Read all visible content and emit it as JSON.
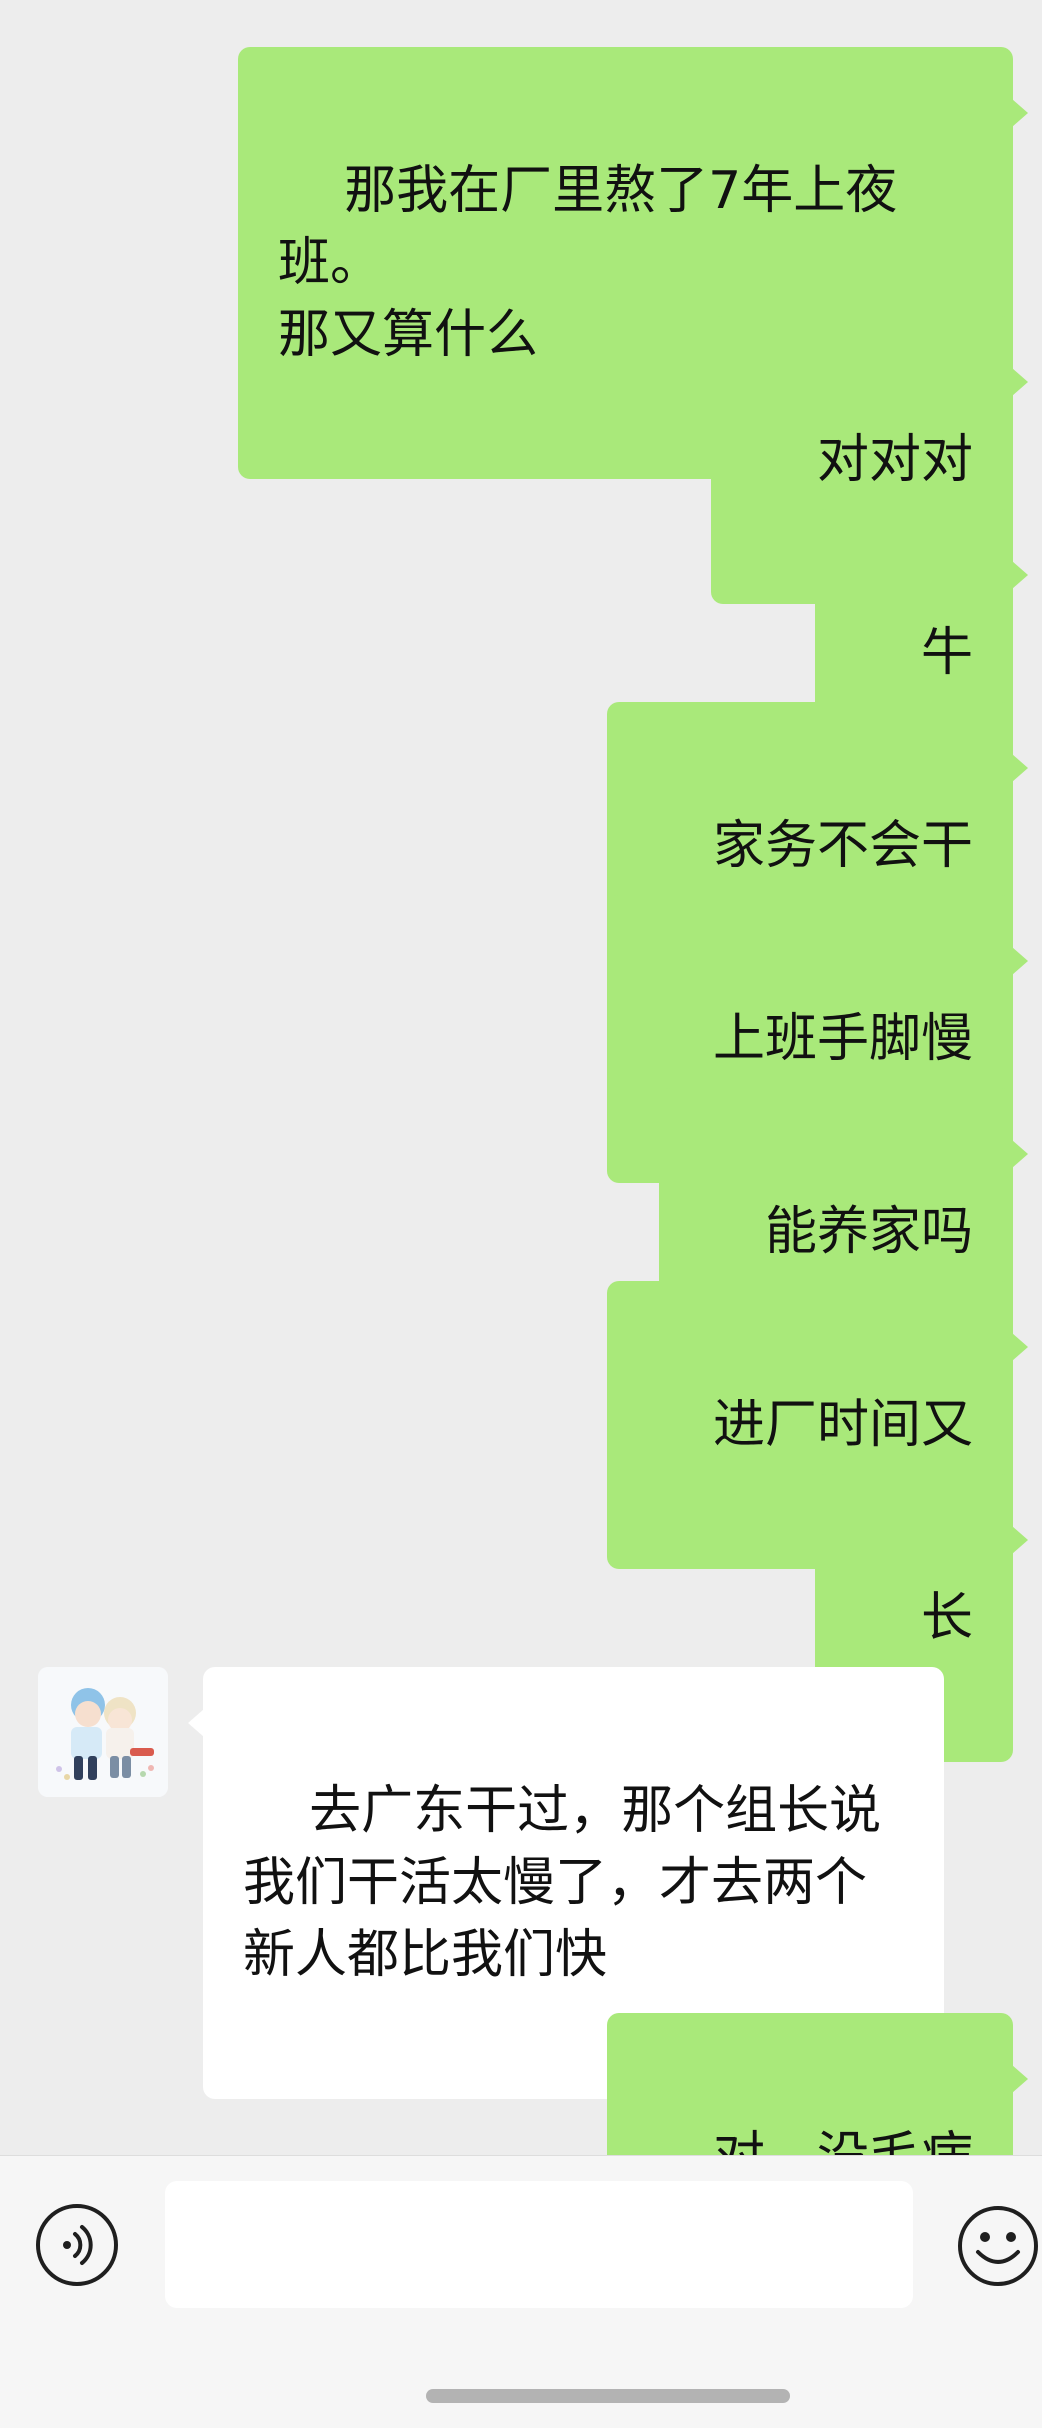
{
  "conversation": {
    "messages": [
      {
        "direction": "out",
        "text": "那我在厂里熬了7年上夜班。\n那又算什么"
      },
      {
        "direction": "out",
        "text": "对对对"
      },
      {
        "direction": "out",
        "text": "牛"
      },
      {
        "direction": "out",
        "text": "家务不会干"
      },
      {
        "direction": "out",
        "text": "上班手脚慢"
      },
      {
        "direction": "out",
        "text": "能养家吗"
      },
      {
        "direction": "out",
        "text": "进厂时间又"
      },
      {
        "direction": "out",
        "text": "长"
      },
      {
        "direction": "in",
        "text": "去广东干过，那个组长说我们干活太慢了，才去两个新人都比我们快"
      },
      {
        "direction": "out",
        "text": "对，没毛病"
      }
    ]
  },
  "input_bar": {
    "text_value": "",
    "voice_icon": "voice-icon",
    "emoji_icon": "emoji-icon"
  },
  "colors": {
    "outgoing_bubble": "#a9e97a",
    "incoming_bubble": "#ffffff",
    "chat_background": "#ededed",
    "input_bar_background": "#f6f6f6"
  }
}
